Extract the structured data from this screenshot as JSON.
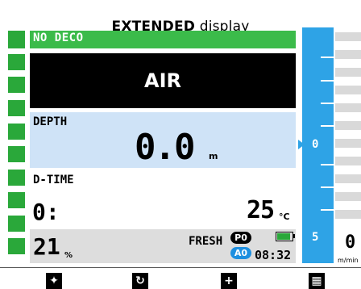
{
  "caption": {
    "top_text": "",
    "title_bold": "EXTENDED",
    "title_rest": " display"
  },
  "status": {
    "nodeco": "NO DECO",
    "gas": "AIR"
  },
  "depth": {
    "label": "DEPTH",
    "value": "0.0",
    "unit": "m"
  },
  "dive_time": {
    "label": "D-TIME",
    "value": "0:"
  },
  "temperature": {
    "value": "25",
    "unit": "°C"
  },
  "oxygen": {
    "value": "21",
    "unit": "%"
  },
  "tissue": {
    "label": "FRESH",
    "p_badge": "P0",
    "a_badge": "A0",
    "time": "08:32"
  },
  "battery": {
    "level": 1.0
  },
  "depth_scale": {
    "marks": [
      "0",
      "5"
    ]
  },
  "vertical_speed": {
    "value": "0",
    "unit": "m/min"
  },
  "softkeys": [
    {
      "name": "softkey-1",
      "icon": "mode-icon",
      "glyph": "✦"
    },
    {
      "name": "softkey-2",
      "icon": "cycle-icon",
      "glyph": "↻"
    },
    {
      "name": "softkey-3",
      "icon": "plus-icon",
      "glyph": "+"
    },
    {
      "name": "softkey-4",
      "icon": "menu-grid-icon",
      "glyph": "▦"
    }
  ],
  "colors": {
    "green": "#2aa83a",
    "blue": "#2ea3e6",
    "depth_bg": "#cfe3f7"
  }
}
